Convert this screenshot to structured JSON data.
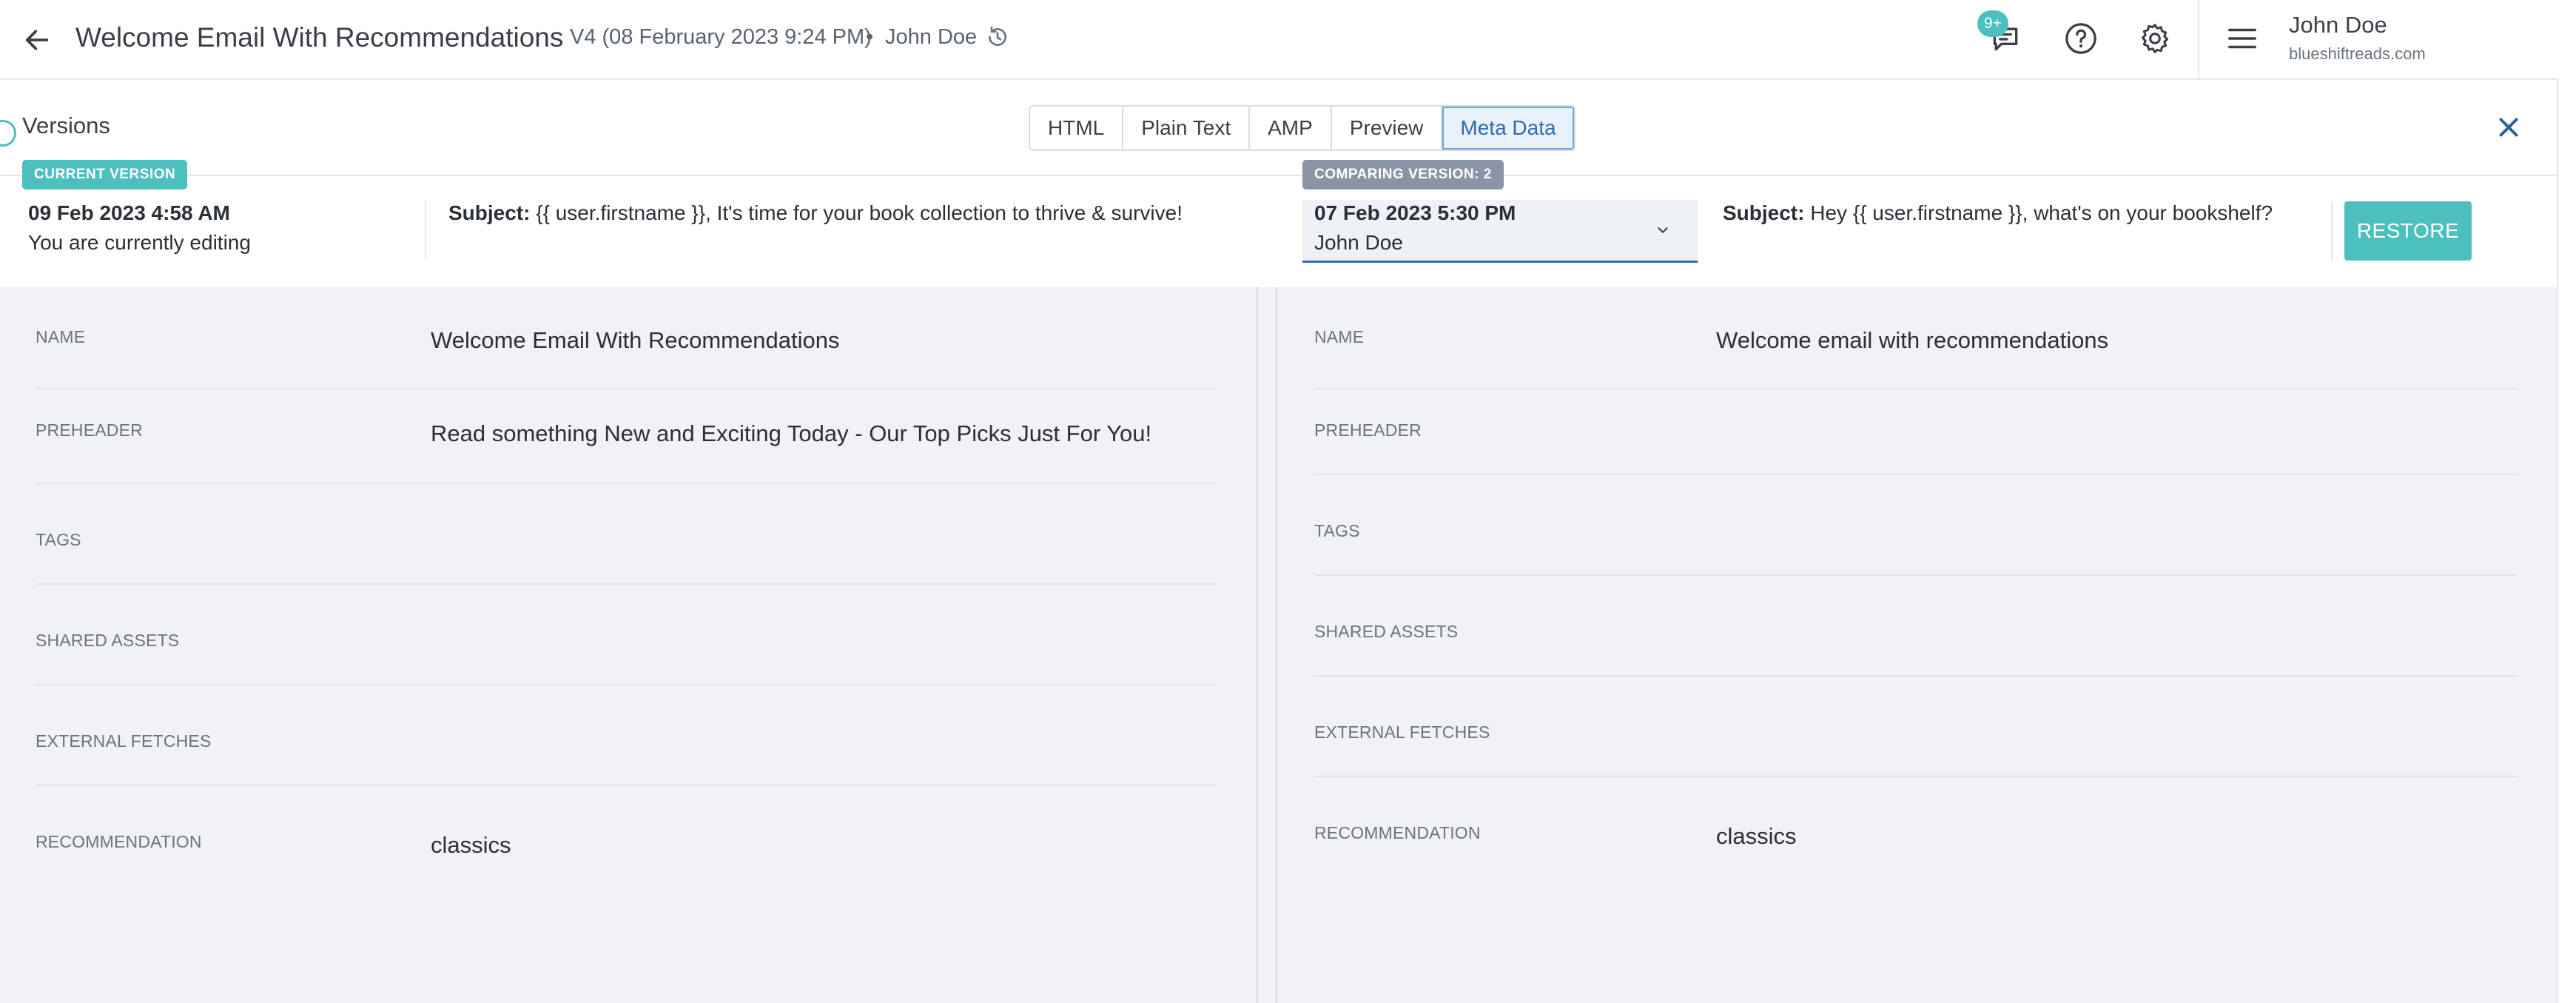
{
  "header": {
    "title": "Welcome Email With Recommendations",
    "version_meta": "V4 (08 February 2023 9:24 PM)",
    "separator": "•",
    "version_user": "John Doe",
    "notification_count": "9+",
    "account": {
      "name": "John Doe",
      "domain": "blueshiftreads.com"
    }
  },
  "versions_panel": {
    "title": "Versions",
    "tabs": [
      {
        "label": "HTML",
        "active": false
      },
      {
        "label": "Plain Text",
        "active": false
      },
      {
        "label": "AMP",
        "active": false
      },
      {
        "label": "Preview",
        "active": false
      },
      {
        "label": "Meta Data",
        "active": true
      }
    ]
  },
  "current_version": {
    "badge": "CURRENT VERSION",
    "date": "09 Feb 2023 4:58 AM",
    "status": "You are currently editing",
    "subject_label": "Subject:",
    "subject": "{{ user.firstname }}, It's time for your book collection to thrive & survive!"
  },
  "comparing_version": {
    "badge": "COMPARING VERSION: 2",
    "date": "07 Feb 2023 5:30 PM",
    "user": "John Doe",
    "subject_label": "Subject:",
    "subject": "Hey {{ user.firstname }}, what's on your bookshelf?",
    "restore_label": "RESTORE"
  },
  "left_meta": [
    {
      "label": "NAME",
      "value": "Welcome Email With Recommendations"
    },
    {
      "label": "PREHEADER",
      "value": "Read something New and Exciting Today - Our Top Picks Just For You!"
    },
    {
      "label": "TAGS",
      "value": ""
    },
    {
      "label": "SHARED ASSETS",
      "value": ""
    },
    {
      "label": "EXTERNAL FETCHES",
      "value": ""
    },
    {
      "label": "RECOMMENDATION",
      "value": "classics"
    }
  ],
  "right_meta": [
    {
      "label": "NAME",
      "value": "Welcome email with recommendations"
    },
    {
      "label": "PREHEADER",
      "value": ""
    },
    {
      "label": "TAGS",
      "value": ""
    },
    {
      "label": "SHARED ASSETS",
      "value": ""
    },
    {
      "label": "EXTERNAL FETCHES",
      "value": ""
    },
    {
      "label": "RECOMMENDATION",
      "value": "classics"
    }
  ],
  "colors": {
    "accent": "#4dbfbf",
    "link": "#2d6cb0",
    "badge_grey": "#8a94a6"
  }
}
